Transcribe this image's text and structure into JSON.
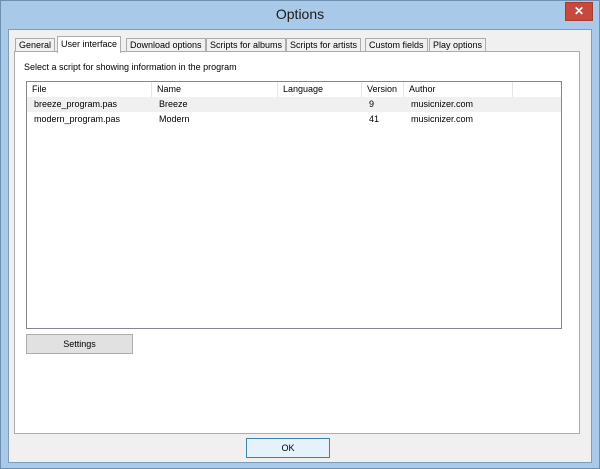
{
  "window": {
    "title": "Options",
    "close_glyph": "✕"
  },
  "tabs": [
    {
      "label": "General",
      "active": false
    },
    {
      "label": "User interface",
      "active": true
    },
    {
      "label": "Download options",
      "active": false
    },
    {
      "label": "Scripts for albums",
      "active": false
    },
    {
      "label": "Scripts for artists",
      "active": false
    },
    {
      "label": "Custom fields",
      "active": false
    },
    {
      "label": "Play options",
      "active": false
    }
  ],
  "panel": {
    "prompt": "Select a script for showing information in the program",
    "columns": [
      "File",
      "Name",
      "Language",
      "Version",
      "Author"
    ],
    "rows": [
      {
        "file": "breeze_program.pas",
        "name": "Breeze",
        "language": "",
        "version": "9",
        "author": "musicnizer.com",
        "selected": true
      },
      {
        "file": "modern_program.pas",
        "name": "Modern",
        "language": "",
        "version": "41",
        "author": "musicnizer.com",
        "selected": false
      }
    ],
    "settings_label": "Settings"
  },
  "footer": {
    "ok_label": "OK"
  }
}
